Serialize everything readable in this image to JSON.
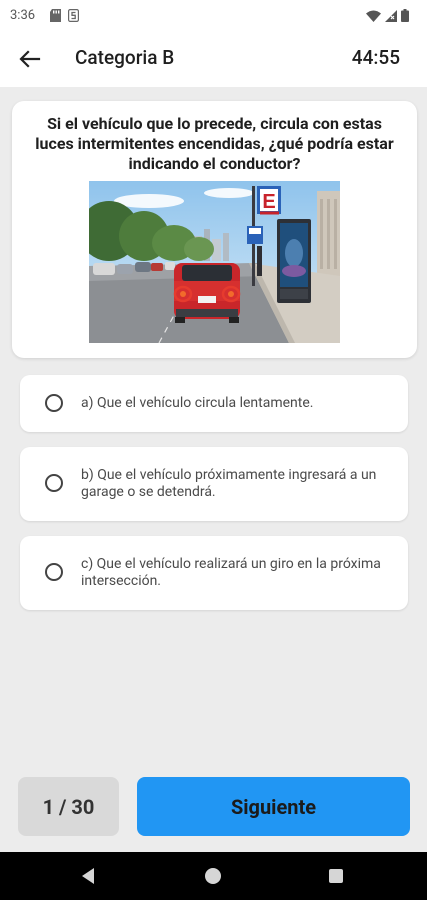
{
  "status_bar": {
    "time": "3:36",
    "left_icons": [
      "sd-card-icon",
      "s-app-icon"
    ],
    "right_icons": [
      "wifi-icon",
      "signal-icon",
      "battery-icon"
    ]
  },
  "app_bar": {
    "back_icon": "arrow-left-icon",
    "title": "Categoria B",
    "timer": "44:55"
  },
  "question": {
    "text": "Si el vehículo que lo precede, circula con estas luces intermitentes encendidas, ¿qué podría estar indicando el conductor?",
    "image_sign_letter": "E"
  },
  "options": [
    {
      "label": "a) Que el vehículo circula lentamente.",
      "selected": false
    },
    {
      "label": "b) Que el vehículo próximamente ingresará a un garage o se detendrá.",
      "selected": false
    },
    {
      "label": "c) Que el vehículo realizará un giro en la próxima intersección.",
      "selected": false
    }
  ],
  "footer": {
    "counter": "1 / 30",
    "next_label": "Siguiente"
  },
  "colors": {
    "accent": "#2196f3",
    "background": "#ececec",
    "counter_bg": "#d9d9d9"
  }
}
